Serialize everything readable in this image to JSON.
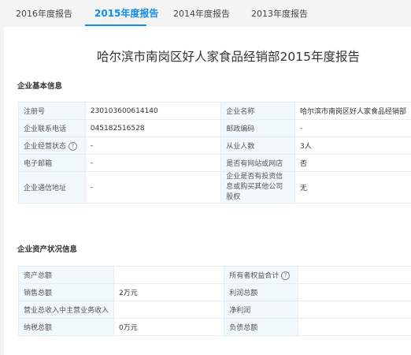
{
  "tabs": [
    {
      "label": "2016年度报告",
      "active": false
    },
    {
      "label": "2015年度报告",
      "active": true
    },
    {
      "label": "2014年度报告",
      "active": false
    },
    {
      "label": "2013年度报告",
      "active": false
    }
  ],
  "report_title": "哈尔滨市南岗区好人家食品经销部2015年度报告",
  "basic_info": {
    "section_title": "企业基本信息",
    "rows": [
      {
        "l1": "注册号",
        "v1": "230103600614140",
        "l2": "企业名称",
        "v2": "哈尔滨市南岗区好人家食品经销部"
      },
      {
        "l1": "企业联系电话",
        "v1": "045182516528",
        "l2": "邮政编码",
        "v2": "-"
      },
      {
        "l1": "企业经营状态",
        "v1": "-",
        "l2": "从业人数",
        "v2": "3人"
      },
      {
        "l1": "电子邮箱",
        "v1": "-",
        "l2": "是否有网站或网店",
        "v2": "否"
      },
      {
        "l1": "企业通信地址",
        "v1": "-",
        "l2": "企业是否有投资信息或购买其他公司股权",
        "v2": "无"
      }
    ]
  },
  "assets_info": {
    "section_title": "企业资产状况信息",
    "rows": [
      {
        "l1": "资产总额",
        "v1": "",
        "l2": "所有者权益合计",
        "v2": ""
      },
      {
        "l1": "销售总额",
        "v1": "2万元",
        "l2": "利润总额",
        "v2": ""
      },
      {
        "l1": "营业总收入中主营业务收入",
        "v1": "",
        "l2": "净利润",
        "v2": ""
      },
      {
        "l1": "纳税总额",
        "v1": "0万元",
        "l2": "负债总额",
        "v2": ""
      }
    ]
  },
  "colors": {
    "accent": "#128bed",
    "label_bg": "#f2f9fc",
    "border": "#e4eef6"
  },
  "icons": {
    "help": "question-circle-icon"
  }
}
